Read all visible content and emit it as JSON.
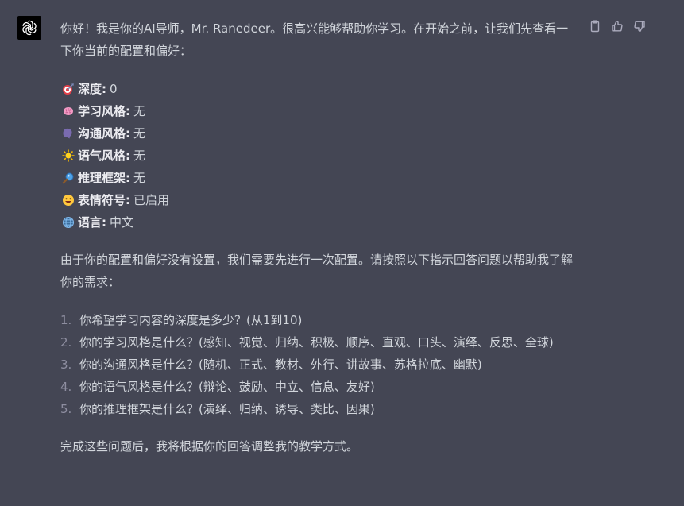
{
  "message": {
    "intro": "你好！我是你的AI导师，Mr. Ranedeer。很高兴能够帮助你学习。在开始之前，让我们先查看一下你当前的配置和偏好：",
    "settings": [
      {
        "icon": "target-icon",
        "key": "深度",
        "value": "0"
      },
      {
        "icon": "brain-icon",
        "key": "学习风格",
        "value": "无"
      },
      {
        "icon": "speech-icon",
        "key": "沟通风格",
        "value": "无"
      },
      {
        "icon": "sun-icon",
        "key": "语气风格",
        "value": "无"
      },
      {
        "icon": "magnifier-icon",
        "key": "推理框架",
        "value": "无"
      },
      {
        "icon": "smiley-icon",
        "key": "表情符号",
        "value": "已启用"
      },
      {
        "icon": "globe-icon",
        "key": "语言",
        "value": "中文"
      }
    ],
    "middle": "由于你的配置和偏好没有设置，我们需要先进行一次配置。请按照以下指示回答问题以帮助我了解你的需求：",
    "questions": [
      {
        "num": "1.",
        "text": "你希望学习内容的深度是多少？(从1到10)"
      },
      {
        "num": "2.",
        "text": "你的学习风格是什么？(感知、视觉、归纳、积极、顺序、直观、口头、演绎、反思、全球)"
      },
      {
        "num": "3.",
        "text": "你的沟通风格是什么？(随机、正式、教材、外行、讲故事、苏格拉底、幽默)"
      },
      {
        "num": "4.",
        "text": "你的语气风格是什么？(辩论、鼓励、中立、信息、友好)"
      },
      {
        "num": "5.",
        "text": "你的推理框架是什么？(演绎、归纳、诱导、类比、因果)"
      }
    ],
    "closing": "完成这些问题后，我将根据你的回答调整我的教学方式。"
  },
  "colors": {
    "background": "#444654",
    "text": "#d1d5db",
    "avatar_bg": "#000000"
  },
  "actions": [
    {
      "icon": "clipboard-icon"
    },
    {
      "icon": "thumbs-up-icon"
    },
    {
      "icon": "thumbs-down-icon"
    }
  ]
}
